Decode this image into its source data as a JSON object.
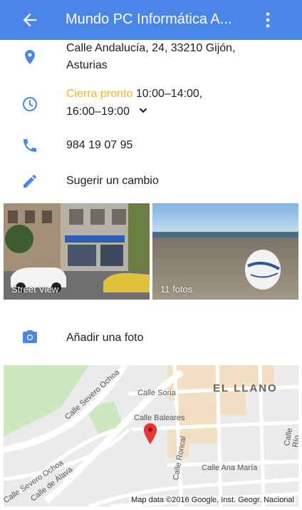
{
  "colors": {
    "app_bar": "#4a86e8",
    "icon": "#4a86e8",
    "warning": "#f6b51d"
  },
  "app_bar": {
    "title": "Mundo PC Informática A...",
    "back_icon": "arrow-back-icon",
    "menu_icon": "more-vert-icon"
  },
  "address": {
    "icon": "location-pin-icon",
    "line1": "Calle Andalucía, 24, 33210 Gijón,",
    "line2": "Asturias"
  },
  "hours": {
    "icon": "clock-icon",
    "status": "Cierra pronto",
    "line1": "10:00–14:00,",
    "line2": "16:00–19:00",
    "expand_icon": "chevron-down-icon"
  },
  "phone": {
    "icon": "phone-icon",
    "number": "984 19 07 95"
  },
  "suggest": {
    "icon": "pencil-icon",
    "label": "Sugerir un cambio"
  },
  "photos": [
    {
      "label": "Street View"
    },
    {
      "label": "11 fotos"
    }
  ],
  "add_photo": {
    "icon": "camera-icon",
    "label": "Añadir una foto"
  },
  "map": {
    "district": "EL LLANO",
    "streets": [
      "Calle Severo Ochoa",
      "Calle Severo Ochoa",
      "Calle Soria",
      "Calle Baleares",
      "Calle Roncal",
      "Calle Ana María",
      "Calle Río de Oro",
      "Calle de Álava"
    ],
    "marker_icon": "map-marker-icon",
    "credit": "Map data ©2016 Google, Inst. Geogr. Nacional"
  }
}
